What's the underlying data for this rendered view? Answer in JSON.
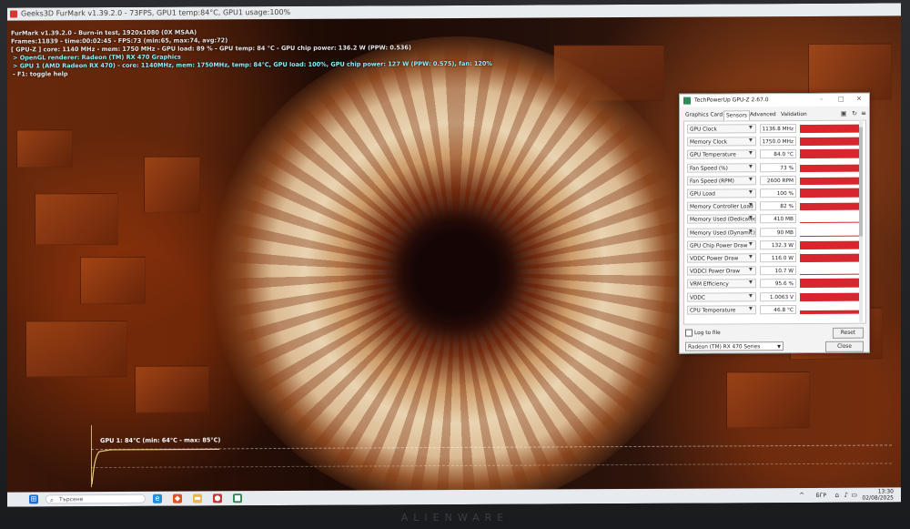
{
  "furmark": {
    "window_title": "Geeks3D FurMark v1.39.2.0 - 73FPS, GPU1 temp:84°C, GPU1 usage:100%",
    "overlay": {
      "line1": "FurMark v1.39.2.0 - Burn-in test, 1920x1080 (0X MSAA)",
      "line2": "Frames:11839 - time:00:02:45 - FPS:73 (min:65, max:74, avg:72)",
      "line3": "[ GPU-Z ] core: 1140 MHz - mem: 1750 MHz - GPU load: 89 % - GPU temp: 84 °C - GPU chip power: 136.2 W (PPW: 0.536)",
      "line4": "> OpenGL renderer: Radeon (TM) RX 470 Graphics",
      "line5": "> GPU 1 (AMD Radeon RX 470) - core: 1140MHz, mem: 1750MHz, temp: 84°C, GPU load: 100%, GPU chip power: 127 W (PPW: 0.575), fan: 120%",
      "line6": "- F1: toggle help"
    },
    "temp_graph_label": "GPU 1: 84°C (min: 64°C - max: 85°C)"
  },
  "gpuz": {
    "title": "TechPowerUp GPU-Z 2.67.0",
    "tabs": [
      "Graphics Card",
      "Sensors",
      "Advanced",
      "Validation"
    ],
    "active_tab": "Sensors",
    "sensors": [
      {
        "name": "GPU Clock",
        "value": "1136.8 MHz",
        "level": 0.85
      },
      {
        "name": "Memory Clock",
        "value": "1750.0 MHz",
        "level": 0.85
      },
      {
        "name": "GPU Temperature",
        "value": "84.0 °C",
        "level": 0.95
      },
      {
        "name": "Fan Speed (%)",
        "value": "73 %",
        "level": 0.75
      },
      {
        "name": "Fan Speed (RPM)",
        "value": "2600 RPM",
        "level": 0.75
      },
      {
        "name": "GPU Load",
        "value": "100 %",
        "level": 1.0
      },
      {
        "name": "Memory Controller Load",
        "value": "82 %",
        "level": 0.82
      },
      {
        "name": "Memory Used (Dedicated)",
        "value": "410 MB",
        "level": 0.1
      },
      {
        "name": "Memory Used (Dynamic)",
        "value": "90 MB",
        "level": 0.05
      },
      {
        "name": "GPU Chip Power Draw",
        "value": "132.3 W",
        "level": 0.85
      },
      {
        "name": "VDDC Power Draw",
        "value": "116.0 W",
        "level": 0.85
      },
      {
        "name": "VDDCI Power Draw",
        "value": "10.7 W",
        "level": 0.12
      },
      {
        "name": "VRM Efficiency",
        "value": "95.6 %",
        "level": 0.95
      },
      {
        "name": "VDDC",
        "value": "1.0063 V",
        "level": 0.9
      },
      {
        "name": "CPU Temperature",
        "value": "46.8 °C",
        "level": 0.4
      }
    ],
    "log_to_file": "Log to file",
    "reset_label": "Reset",
    "close_label": "Close",
    "gpu_select": "Radeon (TM) RX 470 Series"
  },
  "taskbar": {
    "search_placeholder": "Търсене",
    "language": "БГР",
    "time": "13:30",
    "date": "02/08/2025"
  },
  "laptop_brand": "ALIENWARE"
}
